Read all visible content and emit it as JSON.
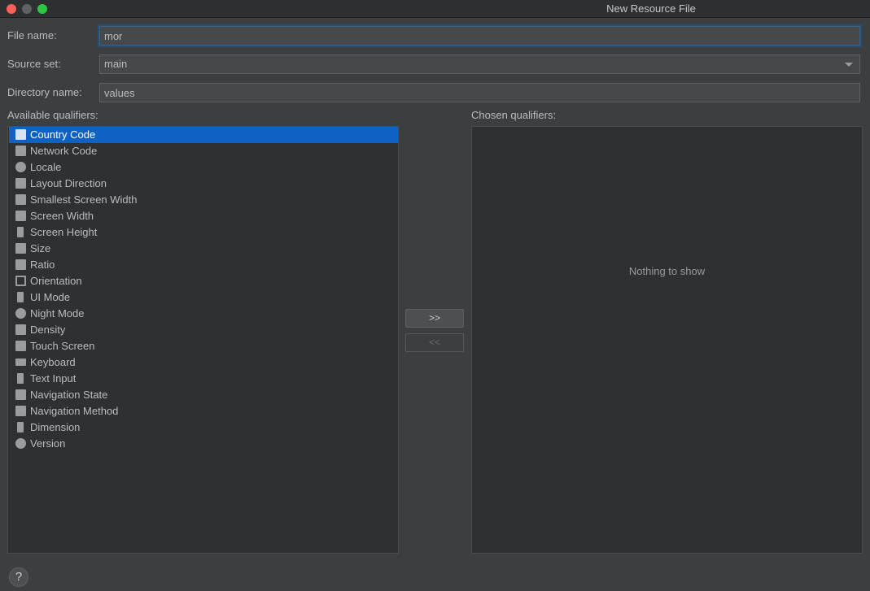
{
  "window": {
    "title": "New Resource File"
  },
  "form": {
    "file_name_label": "File name:",
    "file_name_value": "mor",
    "source_set_label": "Source set:",
    "source_set_value": "main",
    "directory_label": "Directory name:",
    "directory_value": "values"
  },
  "available": {
    "label": "Available qualifiers:",
    "items": [
      {
        "label": "Country Code",
        "icon": "country-code-icon"
      },
      {
        "label": "Network Code",
        "icon": "network-code-icon"
      },
      {
        "label": "Locale",
        "icon": "globe-icon"
      },
      {
        "label": "Layout Direction",
        "icon": "layout-direction-icon"
      },
      {
        "label": "Smallest Screen Width",
        "icon": "smallest-width-icon"
      },
      {
        "label": "Screen Width",
        "icon": "screen-width-icon"
      },
      {
        "label": "Screen Height",
        "icon": "screen-height-icon"
      },
      {
        "label": "Size",
        "icon": "size-icon"
      },
      {
        "label": "Ratio",
        "icon": "ratio-icon"
      },
      {
        "label": "Orientation",
        "icon": "orientation-icon"
      },
      {
        "label": "UI Mode",
        "icon": "ui-mode-icon"
      },
      {
        "label": "Night Mode",
        "icon": "night-mode-icon"
      },
      {
        "label": "Density",
        "icon": "density-icon"
      },
      {
        "label": "Touch Screen",
        "icon": "touch-screen-icon"
      },
      {
        "label": "Keyboard",
        "icon": "keyboard-icon"
      },
      {
        "label": "Text Input",
        "icon": "text-input-icon"
      },
      {
        "label": "Navigation State",
        "icon": "navigation-state-icon"
      },
      {
        "label": "Navigation Method",
        "icon": "navigation-method-icon"
      },
      {
        "label": "Dimension",
        "icon": "dimension-icon"
      },
      {
        "label": "Version",
        "icon": "android-icon"
      }
    ]
  },
  "buttons": {
    "add": ">>",
    "remove": "<<"
  },
  "chosen": {
    "label": "Chosen qualifiers:",
    "empty_text": "Nothing to show"
  },
  "help": {
    "label": "?"
  },
  "colors": {
    "background": "#3c3f41",
    "selection": "#0d62c4",
    "panel": "#2e3133"
  }
}
